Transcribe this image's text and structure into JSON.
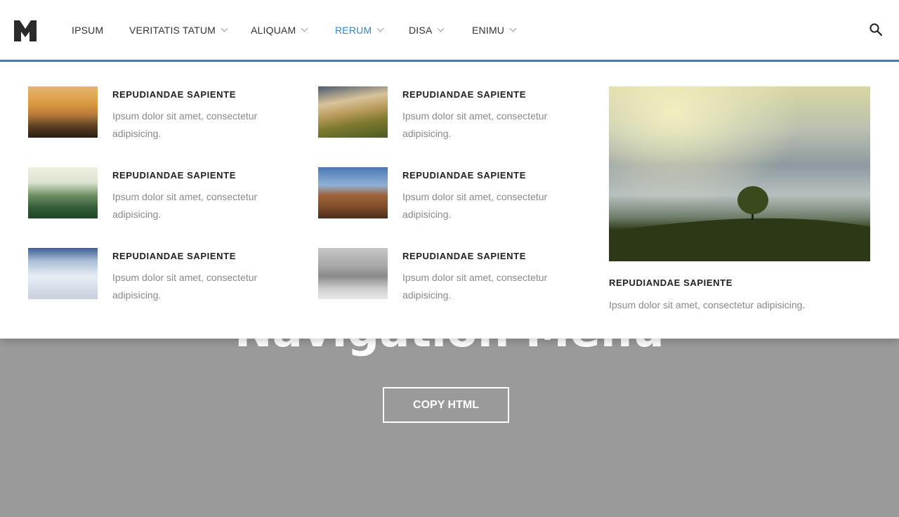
{
  "hero": {
    "title": "Navigation Menu",
    "copy_button": "COPY HTML"
  },
  "nav": {
    "logo_letter": "M",
    "items": [
      {
        "label": "IPSUM",
        "dropdown": false
      },
      {
        "label": "VERITATIS TATUM",
        "dropdown": true
      },
      {
        "label": "ALIQUAM",
        "dropdown": true
      },
      {
        "label": "RERUM",
        "dropdown": true,
        "active": true
      },
      {
        "label": "DISA",
        "dropdown": true
      },
      {
        "label": "ENIMU",
        "dropdown": true
      }
    ],
    "accent_color": "#2a87d6"
  },
  "mega_menu": {
    "items": [
      {
        "title": "REPUDIANDAE SAPIENTE",
        "desc": "Ipsum dolor sit amet, consectetur adipisicing.",
        "image": "misty-sunrise-forest"
      },
      {
        "title": "REPUDIANDAE SAPIENTE",
        "desc": "Ipsum dolor sit amet, consectetur adipisicing.",
        "image": "highland-landscape"
      },
      {
        "title": "REPUDIANDAE SAPIENTE",
        "desc": "Ipsum dolor sit amet, consectetur adipisicing.",
        "image": "foggy-pine-forest"
      },
      {
        "title": "REPUDIANDAE SAPIENTE",
        "desc": "Ipsum dolor sit amet, consectetur adipisicing.",
        "image": "rock-formation"
      },
      {
        "title": "REPUDIANDAE SAPIENTE",
        "desc": "Ipsum dolor sit amet, consectetur adipisicing.",
        "image": "snowy-mountain"
      },
      {
        "title": "REPUDIANDAE SAPIENTE",
        "desc": "Ipsum dolor sit amet, consectetur adipisicing.",
        "image": "snowy-forest"
      }
    ],
    "featured": {
      "title": "REPUDIANDAE SAPIENTE",
      "desc": "Ipsum dolor sit amet, consectetur adipisicing.",
      "image": "lone-tree-on-hill"
    }
  }
}
